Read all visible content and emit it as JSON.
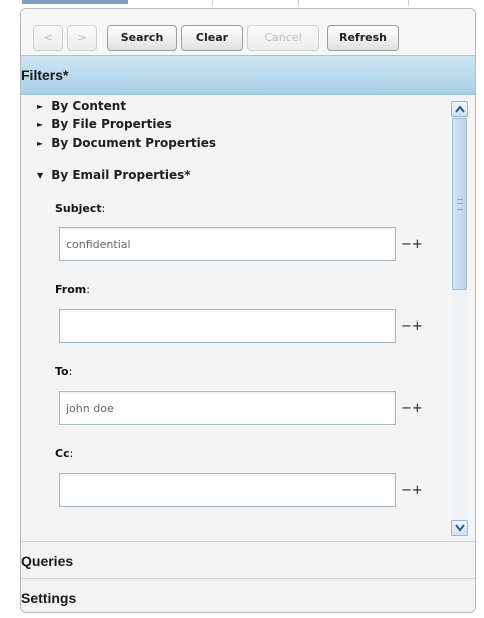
{
  "toolbar": {
    "back_label": "<",
    "forward_label": ">",
    "search_label": "Search",
    "clear_label": "Clear",
    "cancel_label": "Cancel",
    "refresh_label": "Refresh"
  },
  "accordion": {
    "filters_label": "Filters*",
    "queries_label": "Queries",
    "settings_label": "Settings"
  },
  "filters": {
    "sections": [
      {
        "label": "By Content",
        "expanded": false
      },
      {
        "label": "By File Properties",
        "expanded": false
      },
      {
        "label": "By Document Properties",
        "expanded": false
      },
      {
        "label": "By Email Properties*",
        "expanded": true
      }
    ],
    "email_fields": [
      {
        "label": "Subject",
        "colon": ":",
        "value": "confidential"
      },
      {
        "label": "From",
        "colon": ":",
        "value": ""
      },
      {
        "label": "To",
        "colon": ":",
        "value": "john doe"
      },
      {
        "label": "Cc",
        "colon": ":",
        "value": ""
      }
    ],
    "minus": "−",
    "plus": "+"
  },
  "icons": {
    "collapsed": "triangle-right-icon",
    "expanded": "triangle-down-icon"
  },
  "colors": {
    "active_header": "#b9dbee",
    "scrollbar": "#cfdfee"
  }
}
